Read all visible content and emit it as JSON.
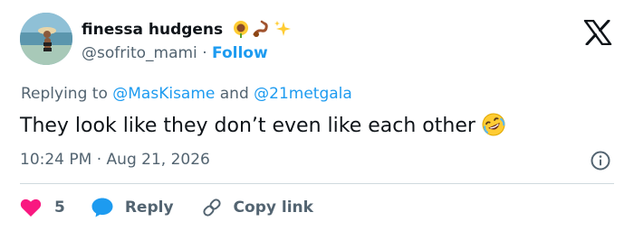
{
  "user": {
    "display_name": "finessa hudgens",
    "name_emojis": [
      "sunflower",
      "scorpion",
      "sparkles"
    ],
    "handle": "@sofrito_mami",
    "separator": "·",
    "follow_label": "Follow"
  },
  "reply": {
    "prefix": "Replying to",
    "mention_1": "@MasKisame",
    "conjunction": "and",
    "mention_2": "@21metgala"
  },
  "tweet": {
    "text": "They look like they don’t even like each other",
    "trailing_emoji": "rolling-on-the-floor-laughing"
  },
  "meta": {
    "time": "10:24 PM",
    "separator": "·",
    "date": "Aug 21, 2026"
  },
  "actions": {
    "like_count": "5",
    "reply_label": "Reply",
    "copy_link_label": "Copy link"
  },
  "colors": {
    "accent": "#1d9bf0",
    "heart": "#f91880",
    "secondary_text": "#536471",
    "primary_text": "#0f1419",
    "divider": "#cfd9de"
  }
}
